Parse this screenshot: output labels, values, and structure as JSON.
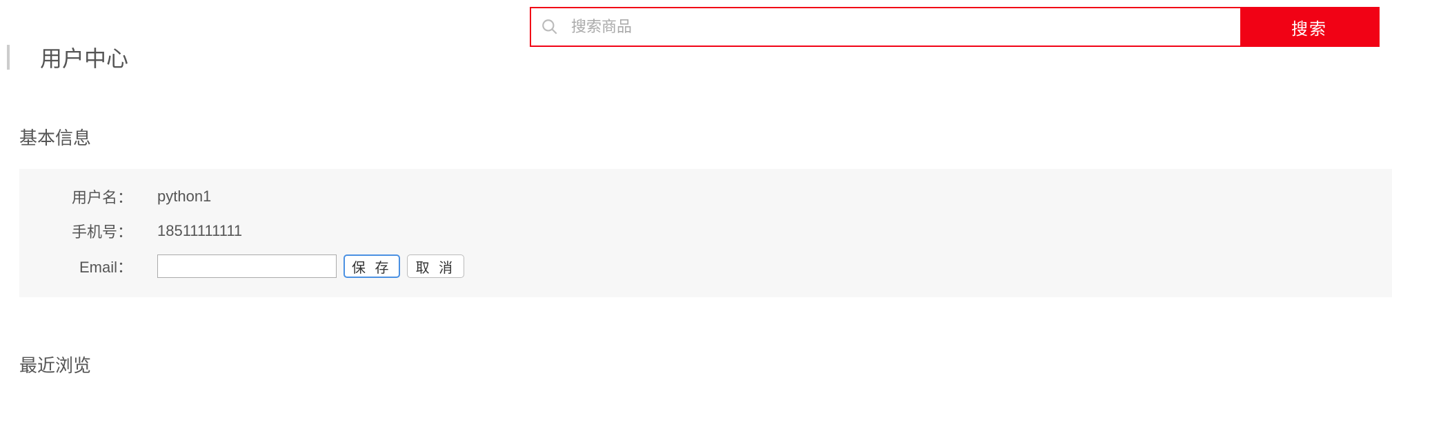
{
  "search": {
    "placeholder": "搜索商品",
    "button_label": "搜索"
  },
  "page": {
    "title": "用户中心"
  },
  "basic_info": {
    "heading": "基本信息",
    "username_label": "用户名：",
    "username_value": "python1",
    "phone_label": "手机号：",
    "phone_value": "18511111111",
    "email_label": "Email：",
    "email_value": "",
    "save_label": "保 存",
    "cancel_label": "取 消"
  },
  "recent": {
    "heading": "最近浏览"
  }
}
